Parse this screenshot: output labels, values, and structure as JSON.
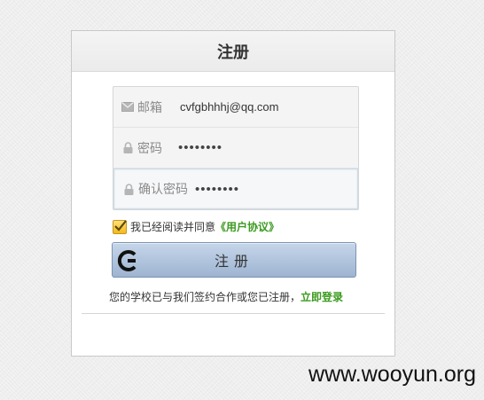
{
  "header": {
    "title": "注册"
  },
  "fields": [
    {
      "icon": "mail-icon",
      "label": "邮箱",
      "value": "cvfgbhhhj@qq.com"
    },
    {
      "icon": "lock-icon",
      "label": "密码",
      "value": "••••••••"
    },
    {
      "icon": "lock-icon",
      "label": "确认密码",
      "value": "••••••••"
    }
  ],
  "agreement": {
    "checked": true,
    "text": "我已经阅读并同意",
    "link": "《用户协议》"
  },
  "register_button": {
    "label": "注册",
    "logo": "brand-logo-icon"
  },
  "login_prompt": {
    "text": "您的学校已与我们签约合作或您已注册，",
    "link": "立即登录"
  },
  "watermark": "www.wooyun.org",
  "colors": {
    "link_green": "#3b9a1e",
    "button_blue": "#a8bdd8",
    "checkbox_gold": "#f2b91c"
  }
}
